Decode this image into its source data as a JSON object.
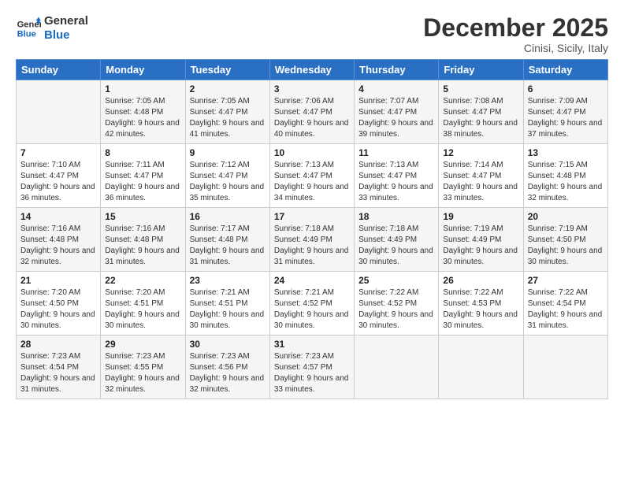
{
  "logo": {
    "line1": "General",
    "line2": "Blue"
  },
  "title": "December 2025",
  "subtitle": "Cinisi, Sicily, Italy",
  "days_header": [
    "Sunday",
    "Monday",
    "Tuesday",
    "Wednesday",
    "Thursday",
    "Friday",
    "Saturday"
  ],
  "weeks": [
    [
      {
        "day": "",
        "sunrise": "",
        "sunset": "",
        "daylight": ""
      },
      {
        "day": "1",
        "sunrise": "Sunrise: 7:05 AM",
        "sunset": "Sunset: 4:48 PM",
        "daylight": "Daylight: 9 hours and 42 minutes."
      },
      {
        "day": "2",
        "sunrise": "Sunrise: 7:05 AM",
        "sunset": "Sunset: 4:47 PM",
        "daylight": "Daylight: 9 hours and 41 minutes."
      },
      {
        "day": "3",
        "sunrise": "Sunrise: 7:06 AM",
        "sunset": "Sunset: 4:47 PM",
        "daylight": "Daylight: 9 hours and 40 minutes."
      },
      {
        "day": "4",
        "sunrise": "Sunrise: 7:07 AM",
        "sunset": "Sunset: 4:47 PM",
        "daylight": "Daylight: 9 hours and 39 minutes."
      },
      {
        "day": "5",
        "sunrise": "Sunrise: 7:08 AM",
        "sunset": "Sunset: 4:47 PM",
        "daylight": "Daylight: 9 hours and 38 minutes."
      },
      {
        "day": "6",
        "sunrise": "Sunrise: 7:09 AM",
        "sunset": "Sunset: 4:47 PM",
        "daylight": "Daylight: 9 hours and 37 minutes."
      }
    ],
    [
      {
        "day": "7",
        "sunrise": "Sunrise: 7:10 AM",
        "sunset": "Sunset: 4:47 PM",
        "daylight": "Daylight: 9 hours and 36 minutes."
      },
      {
        "day": "8",
        "sunrise": "Sunrise: 7:11 AM",
        "sunset": "Sunset: 4:47 PM",
        "daylight": "Daylight: 9 hours and 36 minutes."
      },
      {
        "day": "9",
        "sunrise": "Sunrise: 7:12 AM",
        "sunset": "Sunset: 4:47 PM",
        "daylight": "Daylight: 9 hours and 35 minutes."
      },
      {
        "day": "10",
        "sunrise": "Sunrise: 7:13 AM",
        "sunset": "Sunset: 4:47 PM",
        "daylight": "Daylight: 9 hours and 34 minutes."
      },
      {
        "day": "11",
        "sunrise": "Sunrise: 7:13 AM",
        "sunset": "Sunset: 4:47 PM",
        "daylight": "Daylight: 9 hours and 33 minutes."
      },
      {
        "day": "12",
        "sunrise": "Sunrise: 7:14 AM",
        "sunset": "Sunset: 4:47 PM",
        "daylight": "Daylight: 9 hours and 33 minutes."
      },
      {
        "day": "13",
        "sunrise": "Sunrise: 7:15 AM",
        "sunset": "Sunset: 4:48 PM",
        "daylight": "Daylight: 9 hours and 32 minutes."
      }
    ],
    [
      {
        "day": "14",
        "sunrise": "Sunrise: 7:16 AM",
        "sunset": "Sunset: 4:48 PM",
        "daylight": "Daylight: 9 hours and 32 minutes."
      },
      {
        "day": "15",
        "sunrise": "Sunrise: 7:16 AM",
        "sunset": "Sunset: 4:48 PM",
        "daylight": "Daylight: 9 hours and 31 minutes."
      },
      {
        "day": "16",
        "sunrise": "Sunrise: 7:17 AM",
        "sunset": "Sunset: 4:48 PM",
        "daylight": "Daylight: 9 hours and 31 minutes."
      },
      {
        "day": "17",
        "sunrise": "Sunrise: 7:18 AM",
        "sunset": "Sunset: 4:49 PM",
        "daylight": "Daylight: 9 hours and 31 minutes."
      },
      {
        "day": "18",
        "sunrise": "Sunrise: 7:18 AM",
        "sunset": "Sunset: 4:49 PM",
        "daylight": "Daylight: 9 hours and 30 minutes."
      },
      {
        "day": "19",
        "sunrise": "Sunrise: 7:19 AM",
        "sunset": "Sunset: 4:49 PM",
        "daylight": "Daylight: 9 hours and 30 minutes."
      },
      {
        "day": "20",
        "sunrise": "Sunrise: 7:19 AM",
        "sunset": "Sunset: 4:50 PM",
        "daylight": "Daylight: 9 hours and 30 minutes."
      }
    ],
    [
      {
        "day": "21",
        "sunrise": "Sunrise: 7:20 AM",
        "sunset": "Sunset: 4:50 PM",
        "daylight": "Daylight: 9 hours and 30 minutes."
      },
      {
        "day": "22",
        "sunrise": "Sunrise: 7:20 AM",
        "sunset": "Sunset: 4:51 PM",
        "daylight": "Daylight: 9 hours and 30 minutes."
      },
      {
        "day": "23",
        "sunrise": "Sunrise: 7:21 AM",
        "sunset": "Sunset: 4:51 PM",
        "daylight": "Daylight: 9 hours and 30 minutes."
      },
      {
        "day": "24",
        "sunrise": "Sunrise: 7:21 AM",
        "sunset": "Sunset: 4:52 PM",
        "daylight": "Daylight: 9 hours and 30 minutes."
      },
      {
        "day": "25",
        "sunrise": "Sunrise: 7:22 AM",
        "sunset": "Sunset: 4:52 PM",
        "daylight": "Daylight: 9 hours and 30 minutes."
      },
      {
        "day": "26",
        "sunrise": "Sunrise: 7:22 AM",
        "sunset": "Sunset: 4:53 PM",
        "daylight": "Daylight: 9 hours and 30 minutes."
      },
      {
        "day": "27",
        "sunrise": "Sunrise: 7:22 AM",
        "sunset": "Sunset: 4:54 PM",
        "daylight": "Daylight: 9 hours and 31 minutes."
      }
    ],
    [
      {
        "day": "28",
        "sunrise": "Sunrise: 7:23 AM",
        "sunset": "Sunset: 4:54 PM",
        "daylight": "Daylight: 9 hours and 31 minutes."
      },
      {
        "day": "29",
        "sunrise": "Sunrise: 7:23 AM",
        "sunset": "Sunset: 4:55 PM",
        "daylight": "Daylight: 9 hours and 32 minutes."
      },
      {
        "day": "30",
        "sunrise": "Sunrise: 7:23 AM",
        "sunset": "Sunset: 4:56 PM",
        "daylight": "Daylight: 9 hours and 32 minutes."
      },
      {
        "day": "31",
        "sunrise": "Sunrise: 7:23 AM",
        "sunset": "Sunset: 4:57 PM",
        "daylight": "Daylight: 9 hours and 33 minutes."
      },
      {
        "day": "",
        "sunrise": "",
        "sunset": "",
        "daylight": ""
      },
      {
        "day": "",
        "sunrise": "",
        "sunset": "",
        "daylight": ""
      },
      {
        "day": "",
        "sunrise": "",
        "sunset": "",
        "daylight": ""
      }
    ]
  ]
}
